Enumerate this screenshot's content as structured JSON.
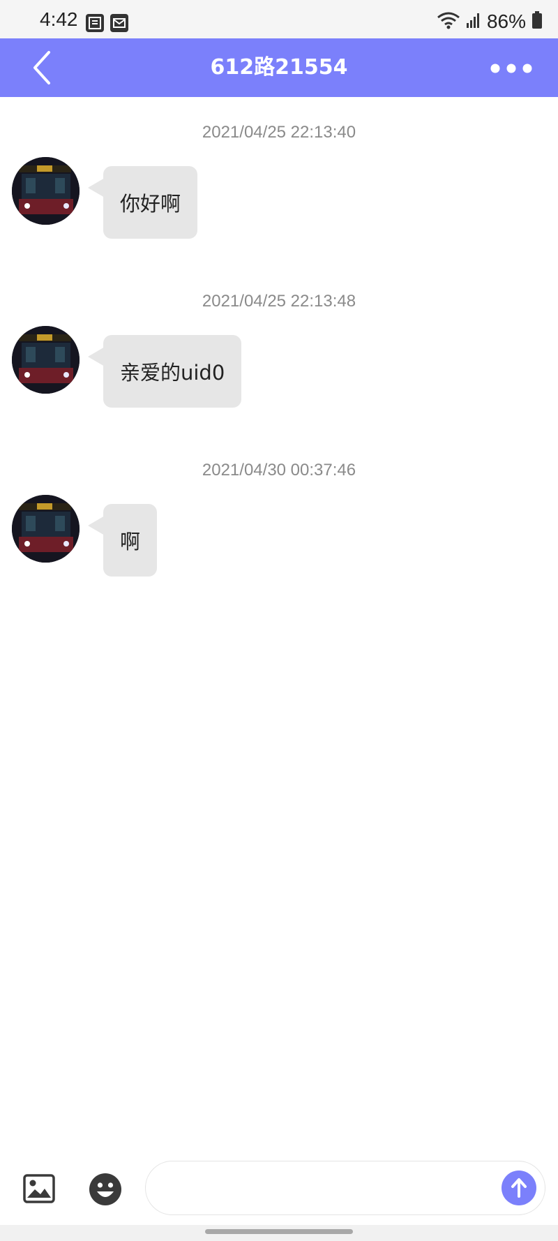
{
  "status_bar": {
    "time": "4:42",
    "notification_icons": [
      "note-app-icon",
      "mail-icon"
    ],
    "battery_percent": "86%",
    "icons": [
      "wifi-icon",
      "signal-icon",
      "battery-icon"
    ]
  },
  "header": {
    "title": "612路21554",
    "background_color": "#7b80fb",
    "back_icon": "chevron-left-icon",
    "more_icon": "more-dots-icon"
  },
  "messages": [
    {
      "timestamp": "2021/04/25 22:13:40",
      "text": "你好啊"
    },
    {
      "timestamp": "2021/04/25 22:13:48",
      "text": "亲爱的uid0"
    },
    {
      "timestamp": "2021/04/30 00:37:46",
      "text": "啊"
    }
  ],
  "input_bar": {
    "image_icon": "image-icon",
    "emoji_icon": "emoji-icon",
    "input_value": "",
    "placeholder": "",
    "send_icon": "arrow-up-icon",
    "accent_color": "#7b80fb"
  }
}
